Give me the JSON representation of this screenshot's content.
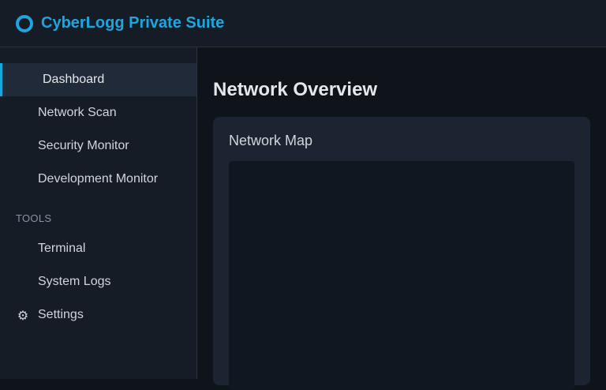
{
  "app": {
    "title": "CyberLogg Private Suite",
    "accent_color": "#1aa7e0",
    "logo_icon": "ring-logo-icon"
  },
  "sidebar": {
    "main_items": [
      {
        "label": "Dashboard",
        "icon": "dashboard-icon",
        "glyph": "",
        "active": true
      },
      {
        "label": "Network Scan",
        "icon": "network-icon",
        "glyph": "",
        "active": false
      },
      {
        "label": "Security Monitor",
        "icon": "shield-icon",
        "glyph": "",
        "active": false
      },
      {
        "label": "Development Monitor",
        "icon": "code-icon",
        "glyph": "",
        "active": false
      }
    ],
    "tools_section_label": "TOOLS",
    "tool_items": [
      {
        "label": "Terminal",
        "icon": "terminal-icon",
        "glyph": ""
      },
      {
        "label": "System Logs",
        "icon": "logs-icon",
        "glyph": ""
      },
      {
        "label": "Settings",
        "icon": "gear-icon",
        "glyph": "⚙"
      }
    ]
  },
  "main": {
    "page_title": "Network Overview",
    "card_title": "Network Map"
  }
}
